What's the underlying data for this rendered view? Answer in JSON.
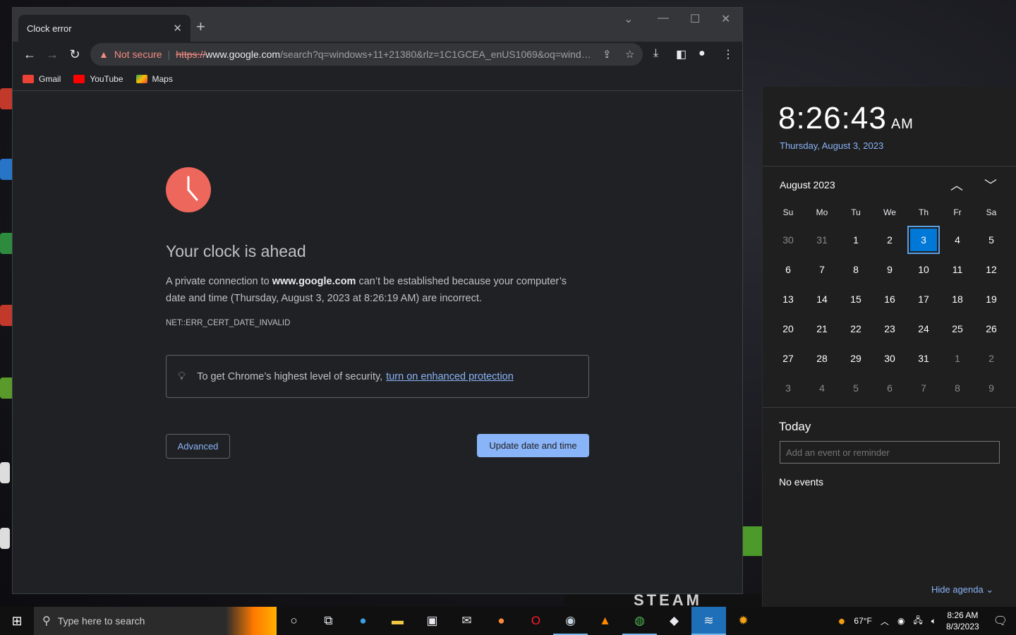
{
  "browser": {
    "tab_title": "Clock error",
    "tab_close_icon": "✕",
    "new_tab_icon": "+",
    "omnibox": {
      "security_label": "Not secure",
      "scheme": "https://",
      "host": "www.google.com",
      "path": "/search?q=windows+11+21380&rlz=1C1GCEA_enUS1069&oq=windo..."
    },
    "bookmarks": [
      {
        "label": "Gmail",
        "color": "#ea4335"
      },
      {
        "label": "YouTube",
        "color": "#ff0000"
      },
      {
        "label": "Maps",
        "color": "#34a853"
      }
    ]
  },
  "error_page": {
    "heading": "Your clock is ahead",
    "msg_prefix": "A private connection to ",
    "msg_host": "www.google.com",
    "msg_suffix": " can’t be established because your computer’s date and time (Thursday, August 3, 2023 at 8:26:19 AM) are incorrect.",
    "error_code": "NET::ERR_CERT_DATE_INVALID",
    "tip_text": "To get Chrome’s highest level of security,",
    "tip_link": "turn on enhanced protection",
    "advanced_label": "Advanced",
    "update_label": "Update date and time"
  },
  "calendar": {
    "time": "8:26:43",
    "ampm": "AM",
    "long_date": "Thursday, August 3, 2023",
    "month_label": "August 2023",
    "weekdays": [
      "Su",
      "Mo",
      "Tu",
      "We",
      "Th",
      "Fr",
      "Sa"
    ],
    "weeks": [
      [
        "30",
        "31",
        "1",
        "2",
        "3",
        "4",
        "5"
      ],
      [
        "6",
        "7",
        "8",
        "9",
        "10",
        "11",
        "12"
      ],
      [
        "13",
        "14",
        "15",
        "16",
        "17",
        "18",
        "19"
      ],
      [
        "20",
        "21",
        "22",
        "23",
        "24",
        "25",
        "26"
      ],
      [
        "27",
        "28",
        "29",
        "30",
        "31",
        "1",
        "2"
      ],
      [
        "3",
        "4",
        "5",
        "6",
        "7",
        "8",
        "9"
      ]
    ],
    "selected_day": "3",
    "today_label": "Today",
    "event_placeholder": "Add an event or reminder",
    "no_events": "No events",
    "hide_agenda": "Hide agenda"
  },
  "background": {
    "steam_text": "STEAM"
  },
  "taskbar": {
    "search_placeholder": "Type here to search",
    "weather": "67°F",
    "clock_time": "8:26 AM",
    "clock_date": "8/3/2023"
  }
}
